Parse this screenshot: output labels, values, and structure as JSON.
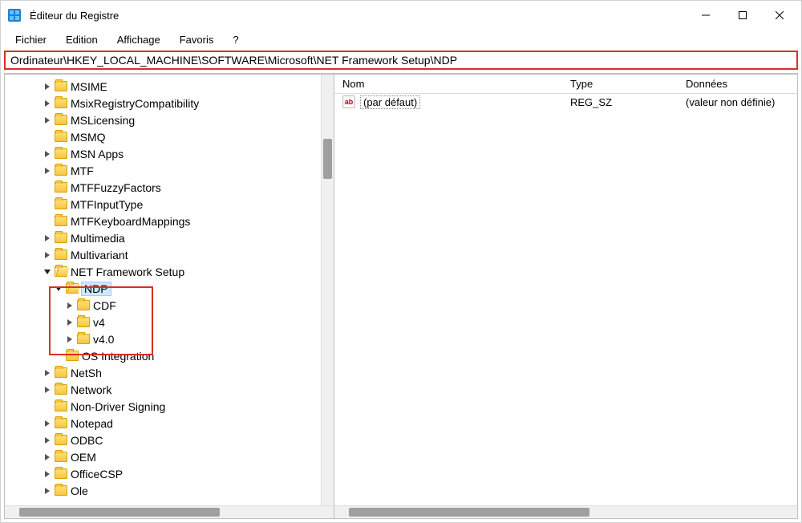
{
  "window": {
    "title": "Éditeur du Registre"
  },
  "menu": {
    "file": "Fichier",
    "edit": "Edition",
    "view": "Affichage",
    "favorites": "Favoris",
    "help": "?"
  },
  "address_path": "Ordinateur\\HKEY_LOCAL_MACHINE\\SOFTWARE\\Microsoft\\NET Framework Setup\\NDP",
  "columns": {
    "name": "Nom",
    "type": "Type",
    "data": "Données"
  },
  "tree": {
    "items": [
      {
        "label": "MSIME",
        "depth": 3,
        "exp": ">",
        "open": false
      },
      {
        "label": "MsixRegistryCompatibility",
        "depth": 3,
        "exp": ">",
        "open": false
      },
      {
        "label": "MSLicensing",
        "depth": 3,
        "exp": ">",
        "open": false
      },
      {
        "label": "MSMQ",
        "depth": 3,
        "exp": "",
        "open": false
      },
      {
        "label": "MSN Apps",
        "depth": 3,
        "exp": ">",
        "open": false
      },
      {
        "label": "MTF",
        "depth": 3,
        "exp": ">",
        "open": false
      },
      {
        "label": "MTFFuzzyFactors",
        "depth": 3,
        "exp": "",
        "open": false
      },
      {
        "label": "MTFInputType",
        "depth": 3,
        "exp": "",
        "open": false
      },
      {
        "label": "MTFKeyboardMappings",
        "depth": 3,
        "exp": "",
        "open": false
      },
      {
        "label": "Multimedia",
        "depth": 3,
        "exp": ">",
        "open": false
      },
      {
        "label": "Multivariant",
        "depth": 3,
        "exp": ">",
        "open": false
      },
      {
        "label": "NET Framework Setup",
        "depth": 3,
        "exp": "v",
        "open": true
      },
      {
        "label": "NDP",
        "depth": 4,
        "exp": "v",
        "open": true,
        "selected": true
      },
      {
        "label": "CDF",
        "depth": 5,
        "exp": ">",
        "open": false
      },
      {
        "label": "v4",
        "depth": 5,
        "exp": ">",
        "open": false
      },
      {
        "label": "v4.0",
        "depth": 5,
        "exp": ">",
        "open": false
      },
      {
        "label": "OS Integration",
        "depth": 4,
        "exp": "",
        "open": false
      },
      {
        "label": "NetSh",
        "depth": 3,
        "exp": ">",
        "open": false
      },
      {
        "label": "Network",
        "depth": 3,
        "exp": ">",
        "open": false
      },
      {
        "label": "Non-Driver Signing",
        "depth": 3,
        "exp": "",
        "open": false
      },
      {
        "label": "Notepad",
        "depth": 3,
        "exp": ">",
        "open": false
      },
      {
        "label": "ODBC",
        "depth": 3,
        "exp": ">",
        "open": false
      },
      {
        "label": "OEM",
        "depth": 3,
        "exp": ">",
        "open": false
      },
      {
        "label": "OfficeCSP",
        "depth": 3,
        "exp": ">",
        "open": false
      },
      {
        "label": "Ole",
        "depth": 3,
        "exp": ">",
        "open": false
      }
    ]
  },
  "values": [
    {
      "name": "(par défaut)",
      "type": "REG_SZ",
      "data": "(valeur non définie)"
    }
  ]
}
